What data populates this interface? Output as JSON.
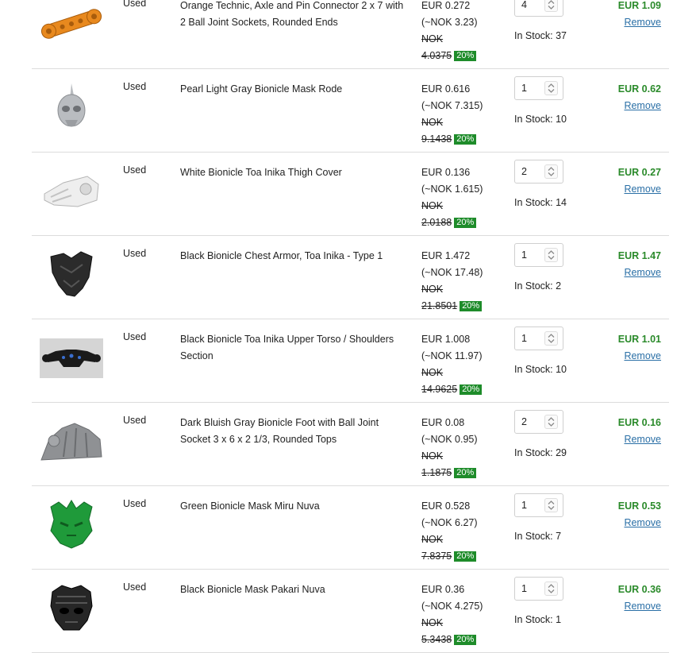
{
  "cart": {
    "items": [
      {
        "condition": "Used",
        "description": "Orange Technic, Axle and Pin Connector 2 x 7 with 2 Ball Joint Sockets, Rounded Ends",
        "price": "EUR 0.272",
        "price_approx": "(~NOK 3.23)",
        "orig_currency": "NOK",
        "orig_value": "4.0375",
        "discount": "20%",
        "quantity": "4",
        "in_stock": "In Stock: 37",
        "total": "EUR 1.09",
        "remove_label": "Remove",
        "thumb_icon": "technic-connector-icon",
        "color": "#e8891e"
      },
      {
        "condition": "Used",
        "description": "Pearl Light Gray Bionicle Mask Rode",
        "price": "EUR 0.616",
        "price_approx": "(~NOK 7.315)",
        "orig_currency": "NOK",
        "orig_value": "9.1438",
        "discount": "20%",
        "quantity": "1",
        "in_stock": "In Stock: 10",
        "total": "EUR 0.62",
        "remove_label": "Remove",
        "thumb_icon": "bionicle-mask-icon",
        "color": "#b9bcc0"
      },
      {
        "condition": "Used",
        "description": "White Bionicle Toa Inika Thigh Cover",
        "price": "EUR 0.136",
        "price_approx": "(~NOK 1.615)",
        "orig_currency": "NOK",
        "orig_value": "2.0188",
        "discount": "20%",
        "quantity": "2",
        "in_stock": "In Stock: 14",
        "total": "EUR 0.27",
        "remove_label": "Remove",
        "thumb_icon": "thigh-cover-icon",
        "color": "#eeeeee"
      },
      {
        "condition": "Used",
        "description": "Black Bionicle Chest Armor, Toa Inika - Type 1",
        "price": "EUR 1.472",
        "price_approx": "(~NOK 17.48)",
        "orig_currency": "NOK",
        "orig_value": "21.8501",
        "discount": "20%",
        "quantity": "1",
        "in_stock": "In Stock: 2",
        "total": "EUR 1.47",
        "remove_label": "Remove",
        "thumb_icon": "chest-armor-icon",
        "color": "#2b2b2b"
      },
      {
        "condition": "Used",
        "description": "Black Bionicle Toa Inika Upper Torso / Shoulders Section",
        "price": "EUR 1.008",
        "price_approx": "(~NOK 11.97)",
        "orig_currency": "NOK",
        "orig_value": "14.9625",
        "discount": "20%",
        "quantity": "1",
        "in_stock": "In Stock: 10",
        "total": "EUR 1.01",
        "remove_label": "Remove",
        "thumb_icon": "upper-torso-icon",
        "color": "#1a1a1a"
      },
      {
        "condition": "Used",
        "description": "Dark Bluish Gray Bionicle Foot with Ball Joint Socket 3 x 6 x 2 1/3, Rounded Tops",
        "price": "EUR 0.08",
        "price_approx": "(~NOK 0.95)",
        "orig_currency": "NOK",
        "orig_value": "1.1875",
        "discount": "20%",
        "quantity": "2",
        "in_stock": "In Stock: 29",
        "total": "EUR 0.16",
        "remove_label": "Remove",
        "thumb_icon": "bionicle-foot-icon",
        "color": "#8f9194"
      },
      {
        "condition": "Used",
        "description": "Green Bionicle Mask Miru Nuva",
        "price": "EUR 0.528",
        "price_approx": "(~NOK 6.27)",
        "orig_currency": "NOK",
        "orig_value": "7.8375",
        "discount": "20%",
        "quantity": "1",
        "in_stock": "In Stock: 7",
        "total": "EUR 0.53",
        "remove_label": "Remove",
        "thumb_icon": "mask-miru-icon",
        "color": "#1f9a3a"
      },
      {
        "condition": "Used",
        "description": "Black Bionicle Mask Pakari Nuva",
        "price": "EUR 0.36",
        "price_approx": "(~NOK 4.275)",
        "orig_currency": "NOK",
        "orig_value": "5.3438",
        "discount": "20%",
        "quantity": "1",
        "in_stock": "In Stock: 1",
        "total": "EUR 0.36",
        "remove_label": "Remove",
        "thumb_icon": "mask-pakari-icon",
        "color": "#262626"
      }
    ]
  }
}
